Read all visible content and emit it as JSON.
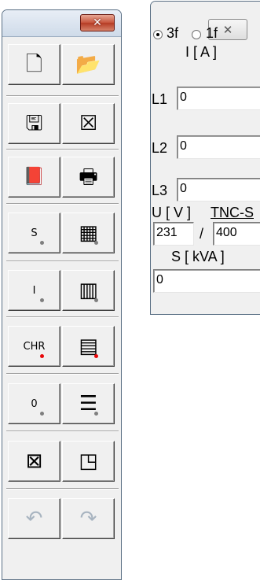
{
  "toolbar": {
    "close_glyph": "✕",
    "rows": [
      [
        {
          "icon": "new-document-icon",
          "glyph": "🗋"
        },
        {
          "icon": "open-folder-icon",
          "glyph": "📂"
        }
      ],
      [
        {
          "icon": "save-icon",
          "glyph": "🖫"
        },
        {
          "icon": "clear-icon",
          "glyph": "☒"
        }
      ],
      [
        {
          "icon": "help-book-icon",
          "glyph": "📕"
        },
        {
          "icon": "printer-icon",
          "glyph": "🖶"
        }
      ],
      [
        {
          "label": "S",
          "dot": "gray"
        },
        {
          "icon": "calculator-table-icon",
          "glyph": "▦",
          "dot": "gray"
        }
      ],
      [
        {
          "label": "I",
          "dot": "gray"
        },
        {
          "icon": "column-table-icon",
          "glyph": "▥",
          "dot": "gray"
        }
      ],
      [
        {
          "label": "CHR",
          "dot": "red"
        },
        {
          "icon": "list-table-icon",
          "glyph": "▤",
          "dot": "red"
        }
      ],
      [
        {
          "label": "0",
          "dot": "gray"
        },
        {
          "icon": "lines-table-icon",
          "glyph": "☰",
          "dot": "gray"
        }
      ],
      [
        {
          "icon": "frame-cross-icon",
          "glyph": "⊠"
        },
        {
          "icon": "corner-page-icon",
          "glyph": "◳"
        }
      ],
      [
        {
          "icon": "undo-icon",
          "glyph": "↶",
          "disabled": true
        },
        {
          "icon": "redo-icon",
          "glyph": "↷",
          "disabled": true
        }
      ]
    ]
  },
  "panel": {
    "close_glyph": "✕",
    "phase_3_label": "3f",
    "phase_1_label": "1f",
    "phase_selected": "3f",
    "current_header": "I [ A ]",
    "l1_label": "L1",
    "l1_value": "0",
    "l2_label": "L2",
    "l2_value": "0",
    "l3_label": "L3",
    "l3_value": "0",
    "voltage_label": "U [ V ]",
    "network_type": "TNC-S",
    "voltage_phase_value": "231",
    "voltage_separator": "/",
    "voltage_line_value": "400",
    "power_header": "S [ kVA ]",
    "power_value": "0"
  },
  "colors": {
    "window_bg": "#f0f0f0",
    "close_red": "#c8573f",
    "status_dot_gray": "#7f7f7f",
    "status_dot_red": "#e8070a"
  }
}
